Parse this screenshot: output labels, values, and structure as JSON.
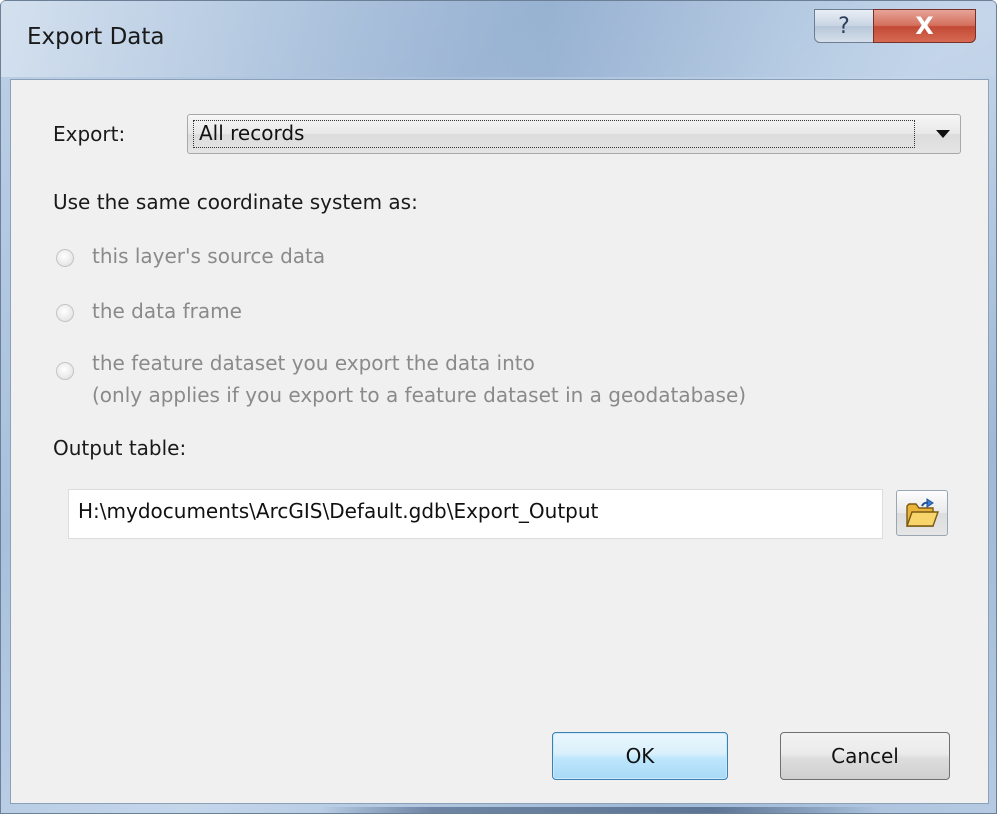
{
  "window": {
    "title": "Export Data",
    "help_label": "?",
    "close_label": "X"
  },
  "export": {
    "label": "Export:",
    "selected": "All records"
  },
  "coord": {
    "heading": "Use the same coordinate system as:",
    "options": [
      {
        "line1": "this layer's source data",
        "line2": ""
      },
      {
        "line1": "the data frame",
        "line2": ""
      },
      {
        "line1": "the feature dataset you export the data into",
        "line2": "(only applies if you export to a feature dataset in a geodatabase)"
      }
    ]
  },
  "output": {
    "label": "Output table:",
    "value": "H:\\mydocuments\\ArcGIS\\Default.gdb\\Export_Output"
  },
  "buttons": {
    "ok": "OK",
    "cancel": "Cancel"
  },
  "icons": {
    "help": "help-icon",
    "close": "close-icon",
    "dropdown": "chevron-down-icon",
    "browse": "open-folder-icon"
  }
}
